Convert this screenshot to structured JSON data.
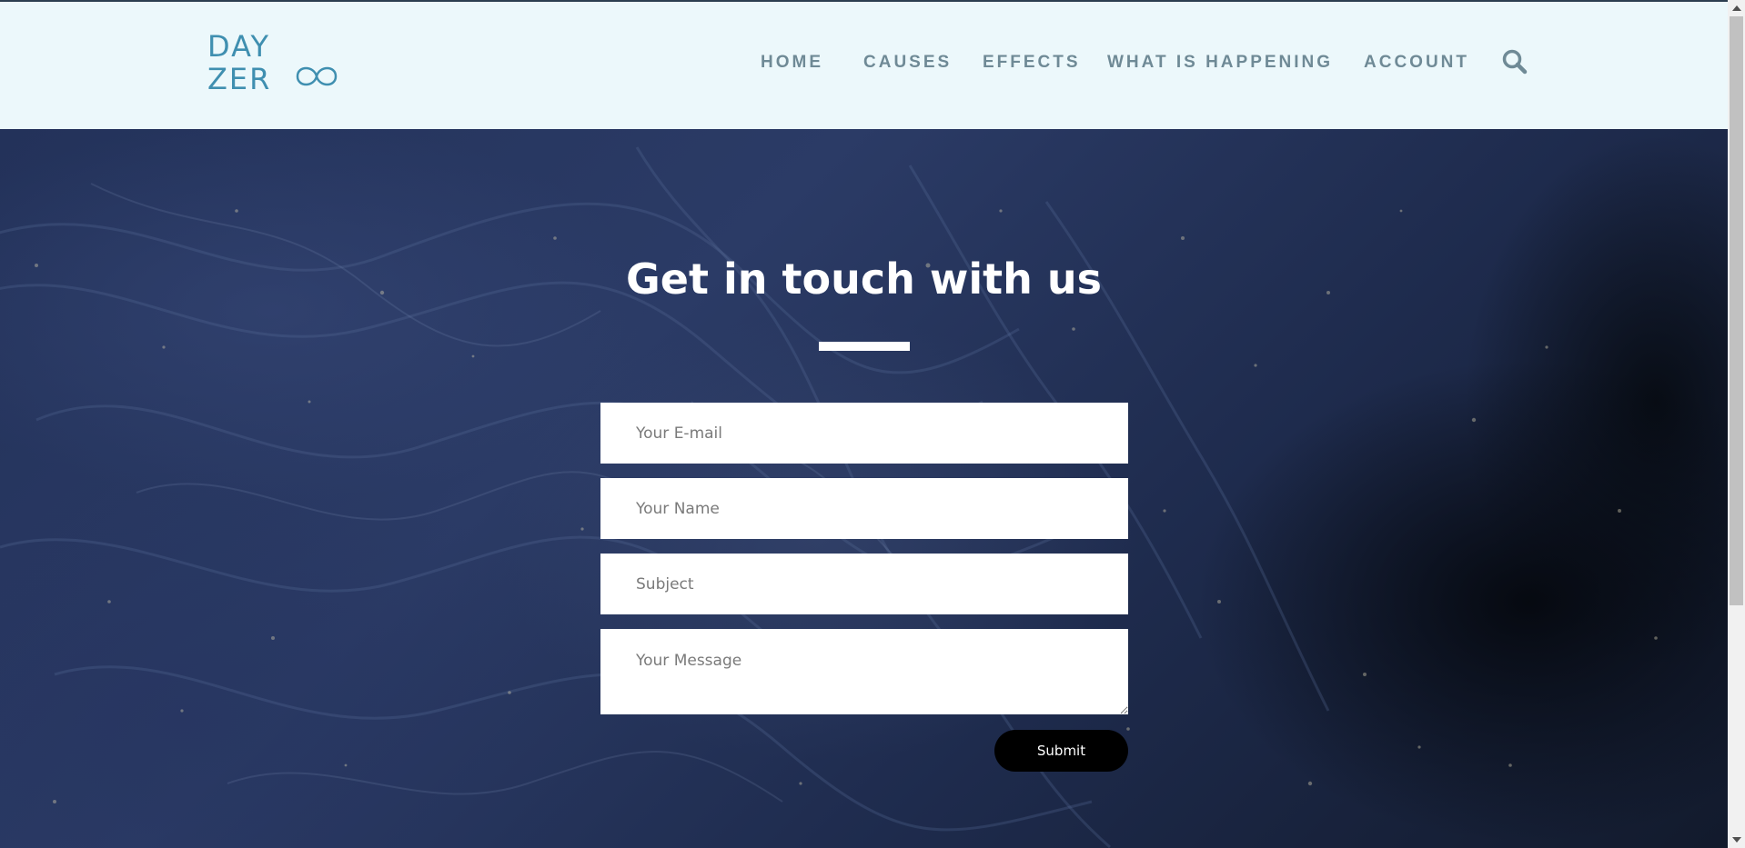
{
  "header": {
    "logo": {
      "line1": "DAY",
      "line2": "ZER",
      "logo_color": "#3f8fb0"
    },
    "nav": [
      {
        "label": "HOME"
      },
      {
        "label": "CAUSES"
      },
      {
        "label": "EFFECTS"
      },
      {
        "label": "WHAT IS HAPPENING"
      },
      {
        "label": "ACCOUNT"
      }
    ],
    "search_icon": "search-icon",
    "background_color": "#ecf8fb",
    "nav_color": "#6f8a96"
  },
  "contact": {
    "title": "Get in touch with us",
    "email_placeholder": "Your E-mail",
    "name_placeholder": "Your Name",
    "subject_placeholder": "Subject",
    "message_placeholder": "Your Message",
    "submit_label": "Submit"
  },
  "colors": {
    "hero_base": "#23325a",
    "button_bg": "#000000",
    "button_text": "#ffffff"
  }
}
